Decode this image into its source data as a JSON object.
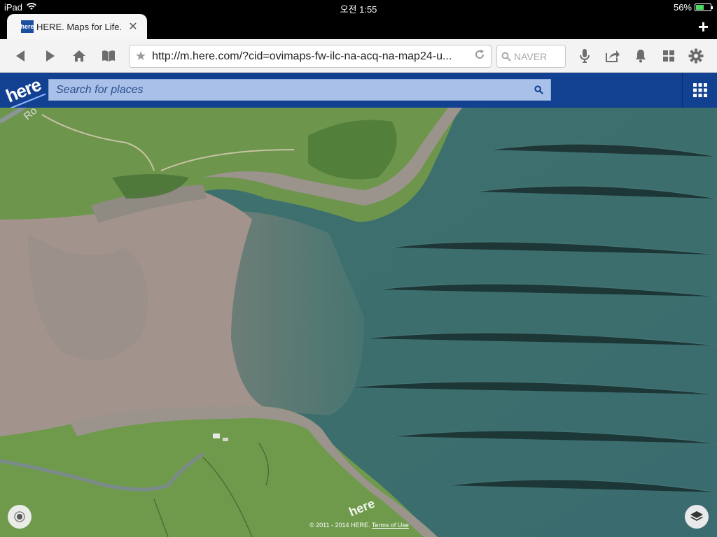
{
  "status": {
    "device": "iPad",
    "time": "오전 1:55",
    "battery": "56%",
    "battery_level": 0.56
  },
  "tab": {
    "favicon_text": "here",
    "title": "HERE. Maps for Life.",
    "close": "✕",
    "new_tab": "+"
  },
  "toolbar": {
    "url": "http://m.here.com/?cid=ovimaps-fw-ilc-na-acq-na-map24-u...",
    "search_placeholder": "NAVER"
  },
  "here": {
    "logo": "here",
    "search_placeholder": "Search for places"
  },
  "map": {
    "road_label": "Ro",
    "watermark": "here",
    "copyright": "© 2011 - 2014 HERE.",
    "terms": "Terms of Use",
    "colors": {
      "sea": "#3e6f6c",
      "sand": "#a0908a",
      "grass": "#6f9a4c",
      "rock": "#9a948c"
    }
  }
}
